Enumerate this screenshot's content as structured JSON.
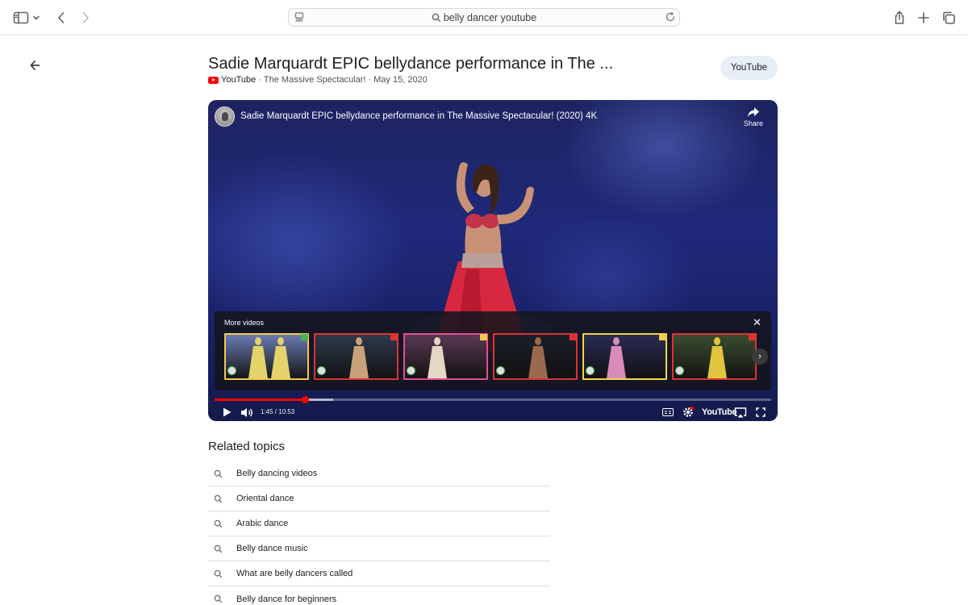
{
  "browser": {
    "search_query": "belly dancer youtube"
  },
  "result": {
    "title": "Sadie Marquardt EPIC bellydance performance in The ...",
    "source": "YouTube",
    "channel": "The Massive Spectacular!",
    "date": "May 15, 2020",
    "separator": "·",
    "chip_label": "YouTube"
  },
  "player": {
    "title": "Sadie Marquardt EPIC bellydance performance in The Massive Spectacular! (2020) 4K",
    "share_label": "Share",
    "more_videos_label": "More videos",
    "time": "1:45 / 10:53",
    "brand": "YouTube",
    "progress_played": 0.163,
    "progress_buffered": 0.213,
    "colors": {
      "progress": "#ff0000",
      "background": "#1d2360"
    },
    "thumbnails": [
      {
        "bg": "#6d7fb8",
        "fig": "#e3d36a",
        "border": "#f2c94c",
        "badge": "#4caf50"
      },
      {
        "bg": "#2f3b4f",
        "fig": "#c8a27a",
        "border": "#d33",
        "badge": "#d33"
      },
      {
        "bg": "#5c3a56",
        "fig": "#e6d7c4",
        "border": "#e24d94",
        "badge": "#f2c94c"
      },
      {
        "bg": "#1b1f2b",
        "fig": "#9a6a4f",
        "border": "#d33",
        "badge": "#d33"
      },
      {
        "bg": "#2a2c55",
        "fig": "#d98ab8",
        "border": "#f2d64b",
        "badge": "#f2c94c"
      },
      {
        "bg": "#3d4f33",
        "fig": "#e2c53c",
        "border": "#d33",
        "badge": "#d33"
      }
    ]
  },
  "related": {
    "title": "Related topics",
    "items": [
      "Belly dancing videos",
      "Oriental dance",
      "Arabic dance",
      "Belly dance music",
      "What are belly dancers called",
      "Belly dance for beginners"
    ]
  }
}
